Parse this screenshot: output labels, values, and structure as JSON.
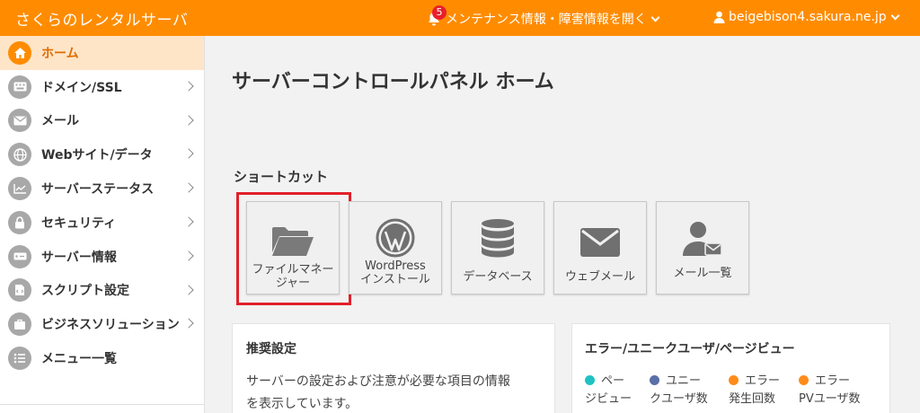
{
  "app": {
    "title": "さくらのレンタルサーバ"
  },
  "header": {
    "maintenance_label": "メンテナンス情報・障害情報を開く",
    "notification_count": "5",
    "user_label": "beigebison4.sakura.ne.jp"
  },
  "sidebar": {
    "items": [
      {
        "label": "ホーム",
        "active": true
      },
      {
        "label": "ドメイン/SSL"
      },
      {
        "label": "メール"
      },
      {
        "label": "Webサイト/データ"
      },
      {
        "label": "サーバーステータス"
      },
      {
        "label": "セキュリティ"
      },
      {
        "label": "サーバー情報"
      },
      {
        "label": "スクリプト設定"
      },
      {
        "label": "ビジネスソリューション"
      },
      {
        "label": "メニュー一覧"
      }
    ]
  },
  "main": {
    "title": "サーバーコントロールパネル ホーム",
    "shortcut_title": "ショートカット",
    "shortcuts": [
      {
        "line1": "ファイルマネー",
        "line2": "ジャー",
        "icon": "folder-icon"
      },
      {
        "line1": "WordPress",
        "line2": "インストール",
        "icon": "wordpress-icon"
      },
      {
        "line1": "データベース",
        "line2": "",
        "icon": "database-icon"
      },
      {
        "line1": "ウェブメール",
        "line2": "",
        "icon": "envelope-icon"
      },
      {
        "line1": "メール一覧",
        "line2": "",
        "icon": "user-mail-icon"
      }
    ],
    "recommend": {
      "title": "推奨設定",
      "text_line1": "サーバーの設定および注意が必要な項目の情報",
      "text_line2": "を表示しています。"
    },
    "stats": {
      "title": "エラー/ユニークユーザ/ページビュー",
      "legend": [
        {
          "line1": "ペー",
          "line2": "ジビュー",
          "color": "#1fc2c2"
        },
        {
          "line1": "ユニー",
          "line2": "クユーザ数",
          "color": "#5b6fa8"
        },
        {
          "line1": "エラー",
          "line2": "発生回数",
          "color": "#ff8c1a"
        },
        {
          "line1": "エラー",
          "line2": "PVユーザ数",
          "color": "#ff8c1a"
        }
      ]
    }
  },
  "colors": {
    "brand": "#ff8c00",
    "highlight": "#e0202a"
  }
}
